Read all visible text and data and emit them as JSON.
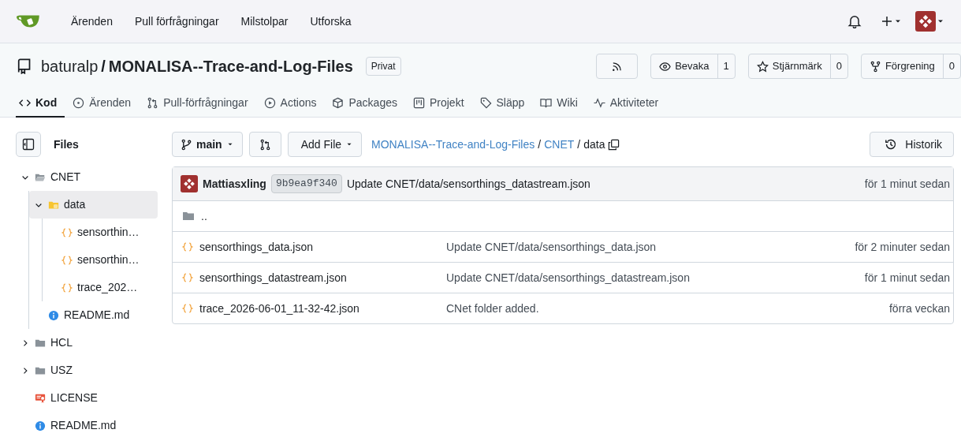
{
  "navbar": {
    "links": [
      "Ärenden",
      "Pull förfrågningar",
      "Milstolpar",
      "Utforska"
    ]
  },
  "repo": {
    "owner": "baturalp",
    "separator": "/",
    "name": "MONALISA--Trace-and-Log-Files",
    "visibility": "Privat",
    "actions": [
      {
        "kind": "rss"
      },
      {
        "kind": "watch",
        "label": "Bevaka",
        "count": "1"
      },
      {
        "kind": "star",
        "label": "Stjärnmärk",
        "count": "0"
      },
      {
        "kind": "fork",
        "label": "Förgrening",
        "count": "0"
      }
    ]
  },
  "tabs": [
    {
      "kind": "code",
      "label": "Kod",
      "selected": true
    },
    {
      "kind": "issue",
      "label": "Ärenden",
      "selected": false
    },
    {
      "kind": "pull",
      "label": "Pull-förfrågningar",
      "selected": false
    },
    {
      "kind": "play",
      "label": "Actions",
      "selected": false
    },
    {
      "kind": "package",
      "label": "Packages",
      "selected": false
    },
    {
      "kind": "project",
      "label": "Projekt",
      "selected": false
    },
    {
      "kind": "tag",
      "label": "Släpp",
      "selected": false
    },
    {
      "kind": "book",
      "label": "Wiki",
      "selected": false
    },
    {
      "kind": "pulse",
      "label": "Aktiviteter",
      "selected": false
    }
  ],
  "sidebar": {
    "title": "Files",
    "items": [
      {
        "kind": "folder",
        "label": "CNET",
        "expanded": true,
        "selected": false,
        "children": [
          {
            "kind": "folder-data",
            "label": "data",
            "expanded": true,
            "selected": true,
            "children": [
              {
                "kind": "json",
                "label": "sensorthin…",
                "selected": false
              },
              {
                "kind": "json",
                "label": "sensorthin…",
                "selected": false
              },
              {
                "kind": "json",
                "label": "trace_202…",
                "selected": false
              }
            ]
          },
          {
            "kind": "readme",
            "label": "README.md",
            "selected": false
          }
        ]
      },
      {
        "kind": "folder",
        "label": "HCL",
        "expanded": false,
        "selected": false
      },
      {
        "kind": "folder",
        "label": "USZ",
        "expanded": false,
        "selected": false
      },
      {
        "kind": "license",
        "label": "LICENSE",
        "selected": false
      },
      {
        "kind": "readme",
        "label": "README.md",
        "selected": false
      }
    ]
  },
  "toolbar": {
    "branch": "main",
    "add_file": "Add File",
    "path": [
      {
        "label": "MONALISA--Trace-and-Log-Files",
        "link": true
      },
      {
        "label": "/",
        "link": false
      },
      {
        "label": "CNET",
        "link": true
      },
      {
        "label": "/",
        "link": false
      },
      {
        "label": "data",
        "link": false
      }
    ],
    "history": "Historik"
  },
  "commit": {
    "author": "Mattiasxling",
    "sha": "9b9ea9f340",
    "message": "Update CNET/data/sensorthings_datastream.json",
    "time": "för 1 minut sedan"
  },
  "files": [
    {
      "kind": "parent",
      "name": ".."
    },
    {
      "kind": "json",
      "name": "sensorthings_data.json",
      "message": "Update CNET/data/sensorthings_data.json",
      "time": "för 2 minuter sedan"
    },
    {
      "kind": "json",
      "name": "sensorthings_datastream.json",
      "message": "Update CNET/data/sensorthings_datastream.json",
      "time": "för 1 minut sedan"
    },
    {
      "kind": "json",
      "name": "trace_2026-06-01_11-32-42.json",
      "message": "CNet folder added.",
      "time": "förra veckan"
    }
  ]
}
